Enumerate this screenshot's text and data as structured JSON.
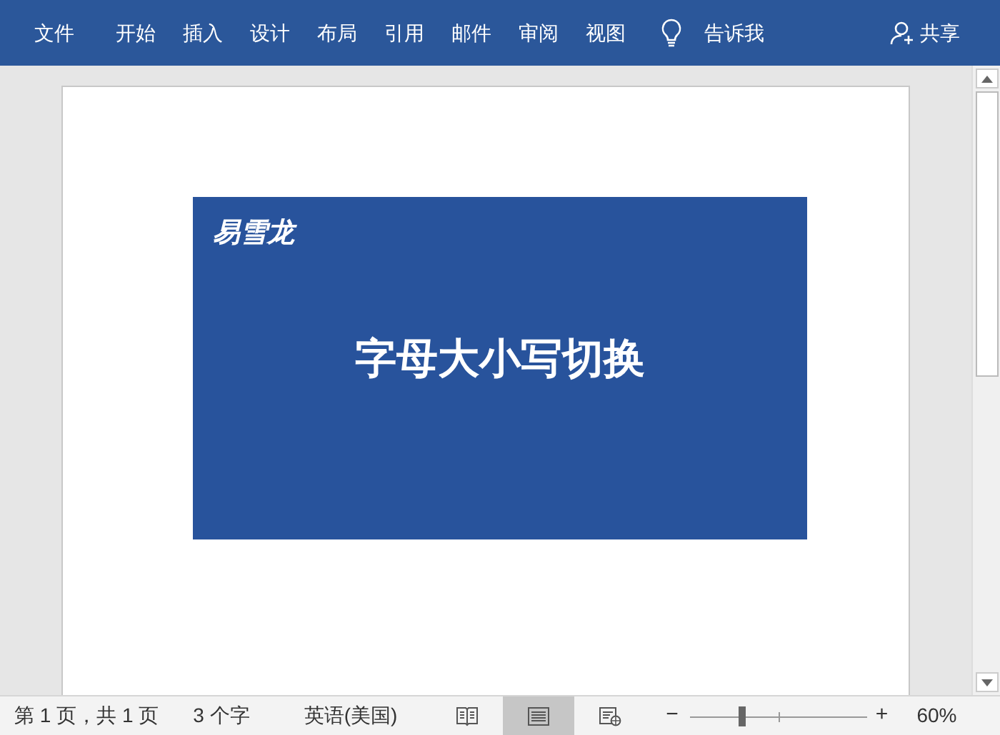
{
  "ribbon": {
    "tabs": [
      {
        "label": "文件",
        "selected": false
      },
      {
        "label": "开始",
        "selected": false
      },
      {
        "label": "插入",
        "selected": false
      },
      {
        "label": "设计",
        "selected": false
      },
      {
        "label": "布局",
        "selected": false
      },
      {
        "label": "引用",
        "selected": false
      },
      {
        "label": "邮件",
        "selected": false
      },
      {
        "label": "审阅",
        "selected": false
      },
      {
        "label": "视图",
        "selected": false
      }
    ],
    "tell_me": "告诉我",
    "share": "共享"
  },
  "banner": {
    "brand": "易雪龙",
    "title": "字母大小写切换"
  },
  "status_bar": {
    "page": "第 1 页，共 1 页",
    "words": "3 个字",
    "language": "英语(美国)",
    "view_buttons": [
      {
        "kind": "read",
        "selected": false
      },
      {
        "kind": "print",
        "selected": true
      },
      {
        "kind": "web",
        "selected": false
      }
    ],
    "zoom": {
      "minus": "−",
      "plus": "+",
      "level": 0.29,
      "reading": "60%"
    }
  }
}
